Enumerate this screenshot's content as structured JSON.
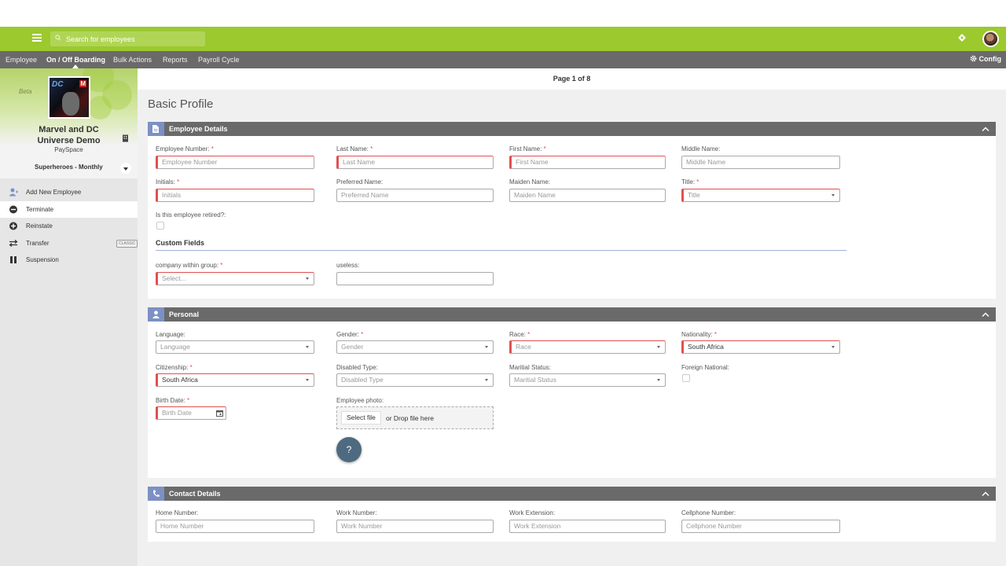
{
  "topbar": {
    "search_placeholder": "Search for employees",
    "accent": "#9bc92e"
  },
  "nav": {
    "items": [
      "Employee",
      "On / Off Boarding",
      "Bulk Actions",
      "Reports",
      "Payroll Cycle"
    ],
    "active": "On / Off Boarding",
    "config": "Config"
  },
  "sidebar": {
    "beta": "Beta",
    "company_name_line1": "Marvel and DC",
    "company_name_line2": "Universe Demo",
    "company_sub": "PaySpace",
    "frequency": "Superheroes - Monthly",
    "menu": [
      {
        "label": "Add New Employee",
        "icon": "add-user-icon"
      },
      {
        "label": "Terminate",
        "icon": "minus-circle-icon"
      },
      {
        "label": "Reinstate",
        "icon": "plus-circle-icon"
      },
      {
        "label": "Transfer",
        "icon": "transfer-arrows-icon",
        "badge": "CLASSIC"
      },
      {
        "label": "Suspension",
        "icon": "pause-icon"
      }
    ]
  },
  "main": {
    "pager": "Page 1 of 8",
    "title": "Basic Profile"
  },
  "employee_details": {
    "title": "Employee Details",
    "employee_number": {
      "label": "Employee Number:",
      "placeholder": "Employee Number"
    },
    "last_name": {
      "label": "Last Name:",
      "placeholder": "Last Name"
    },
    "first_name": {
      "label": "First Name:",
      "placeholder": "First Name"
    },
    "middle_name": {
      "label": "Middle Name:",
      "placeholder": "Middle Name"
    },
    "initials": {
      "label": "Initials:",
      "placeholder": "Initials"
    },
    "preferred_name": {
      "label": "Preferred Name:",
      "placeholder": "Preferred Name"
    },
    "maiden_name": {
      "label": "Maiden Name:",
      "placeholder": "Maiden Name"
    },
    "title_field": {
      "label": "Title:",
      "placeholder": "Title"
    },
    "retired": {
      "label": "Is this employee retired?:"
    },
    "custom_fields": "Custom Fields",
    "company_within_group": {
      "label": "company within group:",
      "placeholder": "Select..."
    },
    "useless": {
      "label": "useless:"
    }
  },
  "personal": {
    "title": "Personal",
    "language": {
      "label": "Language:",
      "value": "Language"
    },
    "gender": {
      "label": "Gender:",
      "value": "Gender"
    },
    "race": {
      "label": "Race:",
      "value": "Race"
    },
    "nationality": {
      "label": "Nationality:",
      "value": "South Africa"
    },
    "citizenship": {
      "label": "Citizenship:",
      "value": "South Africa"
    },
    "disabled_type": {
      "label": "Disabled Type:",
      "value": "Disabled Type"
    },
    "marital_status": {
      "label": "Maritial Status:",
      "value": "Maritial Status"
    },
    "foreign_national": {
      "label": "Foreign National:"
    },
    "birth_date": {
      "label": "Birth Date:",
      "placeholder": "Birth Date"
    },
    "photo": {
      "label": "Employee photo:",
      "button": "Select file",
      "drop_text": "or Drop file here"
    },
    "help": "?"
  },
  "contact": {
    "title": "Contact Details",
    "home_number": {
      "label": "Home Number:",
      "placeholder": "Home Number"
    },
    "work_number": {
      "label": "Work Number:",
      "placeholder": "Work Number"
    },
    "work_extension": {
      "label": "Work Extension:",
      "placeholder": "Work Extension"
    },
    "cellphone_number": {
      "label": "Cellphone Number:",
      "placeholder": "Cellphone Number"
    }
  },
  "required_marker": "*"
}
